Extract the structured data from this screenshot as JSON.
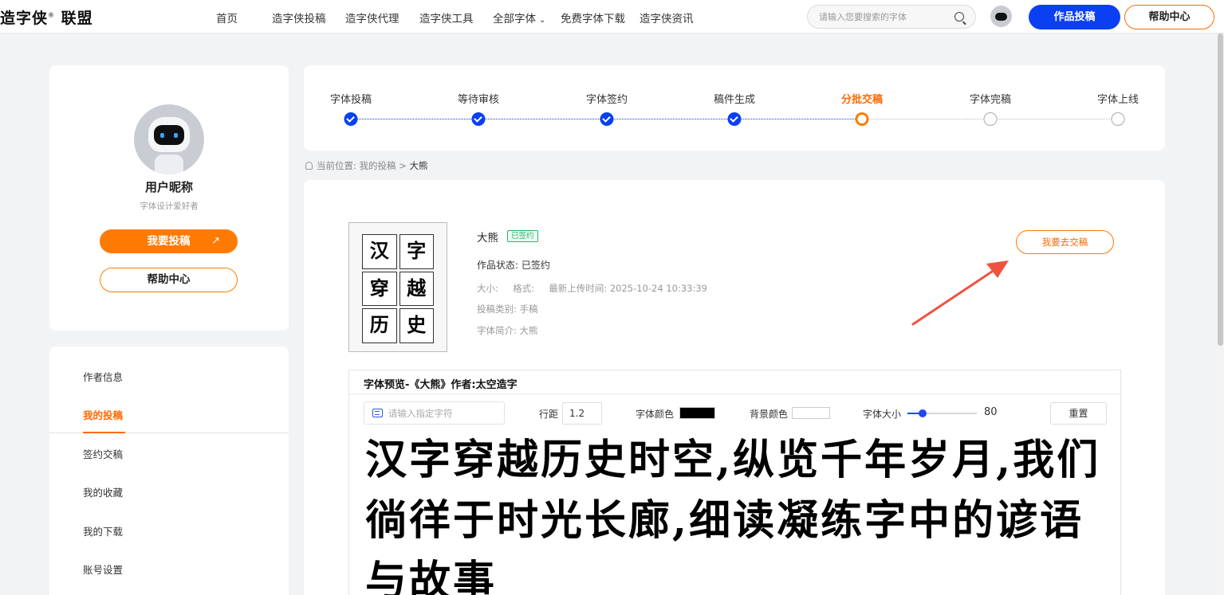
{
  "header": {
    "logo": "造字侠",
    "logo_mark": "®",
    "logo_suffix": " 联盟",
    "nav": [
      "首页",
      "造字侠投稿",
      "造字侠代理",
      "造字侠工具",
      "全部字体",
      "免费字体下载",
      "造字侠资讯"
    ],
    "search_placeholder": "请输入您要搜索的字体",
    "submit_label": "作品投稿",
    "help_label": "帮助中心"
  },
  "profile": {
    "name": "用户昵称",
    "desc": "字体设计爱好者",
    "submit_btn": "我要投稿",
    "submit_arrow": "↗",
    "help_btn": "帮助中心"
  },
  "menu": [
    "作者信息",
    "我的投稿",
    "签约交稿",
    "我的收藏",
    "我的下载",
    "账号设置"
  ],
  "menu_active": "我的投稿",
  "steps": [
    {
      "label": "字体投稿",
      "state": "done"
    },
    {
      "label": "等待审核",
      "state": "done"
    },
    {
      "label": "字体签约",
      "state": "done"
    },
    {
      "label": "稿件生成",
      "state": "done"
    },
    {
      "label": "分批交稿",
      "state": "current"
    },
    {
      "label": "字体完稿",
      "state": "todo"
    },
    {
      "label": "字体上线",
      "state": "todo"
    }
  ],
  "breadcrumb": {
    "prefix": "当前位置:",
    "parent": "我的投稿",
    "sep": ">",
    "current": "大熊"
  },
  "work": {
    "title": "大熊",
    "badge": "已签约",
    "status": "作品状态: 已签约",
    "meta": "大小:     格式:     最新上传时间: 2025-10-24 10:33:39",
    "category": "投稿类别: 手稿",
    "intro": "字体简介: 大熊",
    "deliver_btn": "我要去交稿",
    "thumb_chars": [
      "汉",
      "字",
      "穿",
      "越",
      "历",
      "史"
    ]
  },
  "preview": {
    "title": "字体预览-《大熊》作者:太空造字",
    "char_placeholder": "请输入指定字符",
    "line_spacing_label": "行距",
    "line_spacing_value": "1.2",
    "font_color_label": "字体颜色",
    "font_color": "#000000",
    "bg_color_label": "背景颜色",
    "bg_color": "#ffffff",
    "font_size_label": "字体大小",
    "font_size_value": "80",
    "font_size_fraction": 0.22,
    "reset_btn": "重置",
    "sample_text": "汉字穿越历史时空,纵览千年岁月,我们徜徉于时光长廊,细读凝练字中的谚语与故事"
  },
  "colors": {
    "accent_blue": "#0a3ff2",
    "accent_orange": "#ff7a00",
    "badge_green": "#2ab56a",
    "arrow_red": "#f0523f"
  }
}
